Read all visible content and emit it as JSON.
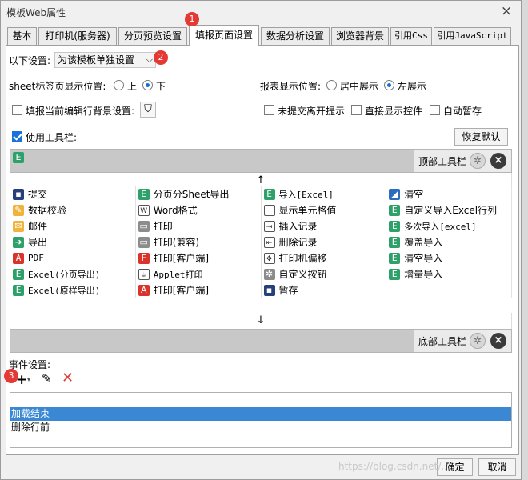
{
  "window": {
    "title": "模板Web属性",
    "close_glyph": "×"
  },
  "tabs": [
    {
      "label": "基本"
    },
    {
      "label": "打印机(服务器)"
    },
    {
      "label": "分页预览设置"
    },
    {
      "label": "填报页面设置",
      "active": true
    },
    {
      "label": "数据分析设置"
    },
    {
      "label": "浏览器背景"
    },
    {
      "label": "引用Css"
    },
    {
      "label": "引用JavaScript"
    }
  ],
  "settings": {
    "scope_label": "以下设置:",
    "scope_value": "为该模板单独设置",
    "sheet_position_label": "sheet标签页显示位置:",
    "sheet_position_options": [
      "上",
      "下"
    ],
    "sheet_position_selected": "下",
    "report_position_label": "报表显示位置:",
    "report_position_options": [
      "居中展示",
      "左展示"
    ],
    "report_position_selected": "左展示",
    "fill_bg_label": "填报当前编辑行背景设置:",
    "unsubmitted_label": "未提交离开提示",
    "direct_control_label": "直接显示控件",
    "autosave_label": "自动暂存",
    "use_toolbar_label": "使用工具栏:",
    "use_toolbar_checked": true,
    "restore_label": "恢复默认"
  },
  "toolbars": {
    "top_label": "顶部工具栏",
    "bottom_label": "底部工具栏",
    "up_arrow": "↑",
    "down_arrow": "↓"
  },
  "buttons_grid": [
    [
      {
        "label": "提交",
        "icon": "save-icon"
      },
      {
        "label": "分页分Sheet导出",
        "icon": "excel-icon"
      },
      {
        "label": "导入[Excel]",
        "icon": "excel-icon"
      },
      {
        "label": "清空",
        "icon": "eraser-icon"
      }
    ],
    [
      {
        "label": "数据校验",
        "icon": "pencil-icon"
      },
      {
        "label": "Word格式",
        "icon": "word-icon"
      },
      {
        "label": "显示单元格值",
        "icon": "cell-icon"
      },
      {
        "label": "自定义导入Excel行列",
        "icon": "excel-icon"
      }
    ],
    [
      {
        "label": "邮件",
        "icon": "mail-icon"
      },
      {
        "label": "打印",
        "icon": "printer-icon"
      },
      {
        "label": "插入记录",
        "icon": "insert-row-icon"
      },
      {
        "label": "多次导入[excel]",
        "icon": "excel-icon"
      }
    ],
    [
      {
        "label": "导出",
        "icon": "export-icon"
      },
      {
        "label": "打印(兼容)",
        "icon": "printer-icon"
      },
      {
        "label": "删除记录",
        "icon": "delete-row-icon"
      },
      {
        "label": "覆盖导入",
        "icon": "excel-icon"
      }
    ],
    [
      {
        "label": "PDF",
        "icon": "pdf-icon"
      },
      {
        "label": "打印[客户端]",
        "icon": "flash-icon"
      },
      {
        "label": "打印机偏移",
        "icon": "move-icon"
      },
      {
        "label": "清空导入",
        "icon": "excel-icon"
      }
    ],
    [
      {
        "label": "Excel(分页导出)",
        "icon": "excel-icon"
      },
      {
        "label": "Applet打印",
        "icon": "applet-icon"
      },
      {
        "label": "自定义按钮",
        "icon": "gear-icon"
      },
      {
        "label": "增量导入",
        "icon": "excel-icon"
      }
    ],
    [
      {
        "label": "Excel(原样导出)",
        "icon": "excel-icon"
      },
      {
        "label": "打印[客户端]",
        "icon": "pdf-icon"
      },
      {
        "label": "暂存",
        "icon": "save-clock-icon"
      },
      {
        "label": "",
        "icon": ""
      }
    ]
  ],
  "events": {
    "label": "事件设置:",
    "items": [
      {
        "label": "加载结束",
        "selected": true
      },
      {
        "label": "删除行前",
        "selected": false
      }
    ]
  },
  "footer": {
    "ok_label": "确定",
    "cancel_label": "取消",
    "watermark": "https://blog.csdn.net/..."
  },
  "annotations": [
    "1",
    "2",
    "3"
  ],
  "colors": {
    "selection": "#3a87d4",
    "badge": "#e53935",
    "accent": "#1a73d9"
  }
}
